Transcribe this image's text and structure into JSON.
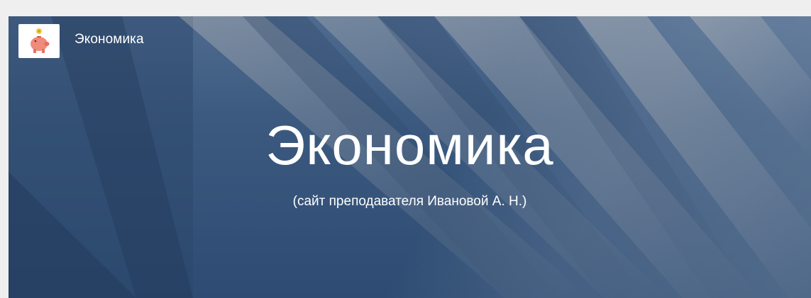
{
  "header": {
    "site_name": "Экономика",
    "logo_icon": "piggy-bank-icon"
  },
  "hero": {
    "title": "Экономика",
    "subtitle": "(сайт преподавателя Ивановой А. Н.)"
  },
  "colors": {
    "hero_base": "#3c5a80",
    "hero_highlight": "#d9cfc3",
    "page_background": "#efefef",
    "text": "#ffffff"
  }
}
